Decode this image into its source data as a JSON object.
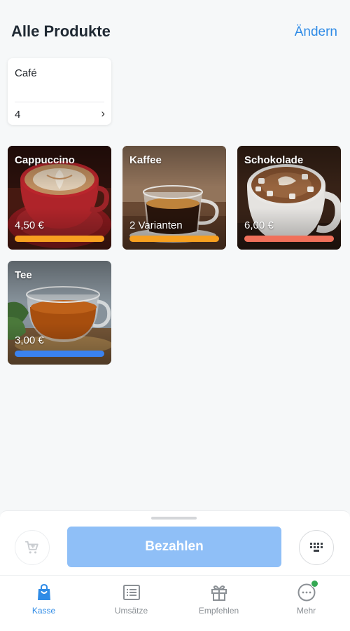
{
  "header": {
    "title": "Alle Produkte",
    "edit_label": "Ändern"
  },
  "category": {
    "name": "Café",
    "count": "4",
    "chevron": "›"
  },
  "products": [
    {
      "name": "Cappuccino",
      "price": "4,50 €",
      "bar_color": "#f7a020"
    },
    {
      "name": "Kaffee",
      "price": "2 Varianten",
      "bar_color": "#f7a020"
    },
    {
      "name": "Schokolade",
      "price": "6,00 €",
      "bar_color": "#f0705a"
    },
    {
      "name": "Tee",
      "price": "3,00 €",
      "bar_color": "#3a82f0"
    }
  ],
  "checkout": {
    "pay_label": "Bezahlen"
  },
  "tabbar": {
    "items": [
      {
        "label": "Kasse",
        "icon": "shopping-bag-icon",
        "active": true
      },
      {
        "label": "Umsätze",
        "icon": "receipt-list-icon",
        "active": false
      },
      {
        "label": "Empfehlen",
        "icon": "gift-icon",
        "active": false
      },
      {
        "label": "Mehr",
        "icon": "more-dots-icon",
        "active": false,
        "badge": true
      }
    ]
  },
  "colors": {
    "accent": "#2f8be6",
    "pay_button": "#8fbff7",
    "badge": "#34a853"
  }
}
